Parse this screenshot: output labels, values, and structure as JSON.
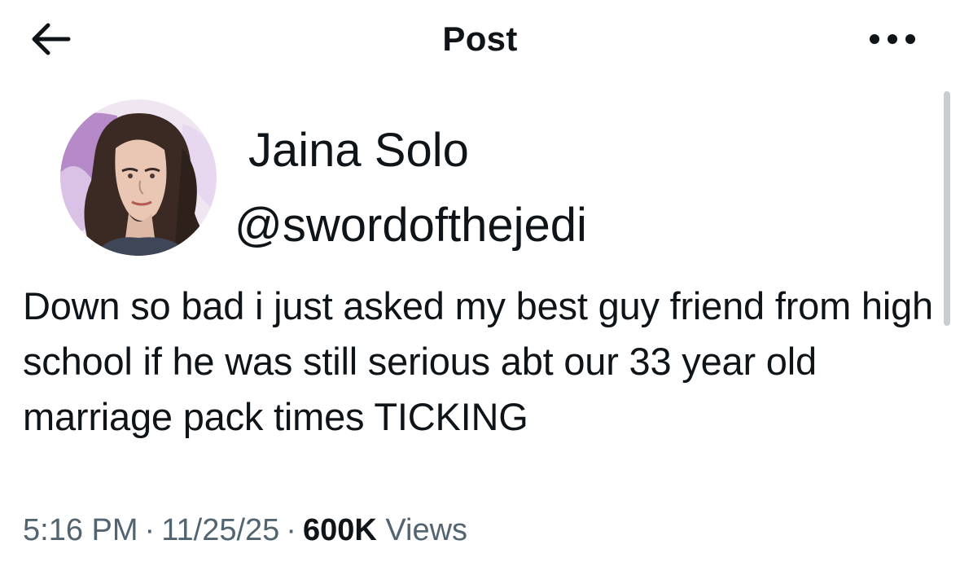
{
  "header": {
    "title": "Post",
    "back_icon": "arrow-left-icon",
    "more_icon": "more-horizontal-icon"
  },
  "author": {
    "display_name": "Jaina Solo",
    "handle": "@swordofthejedi",
    "avatar": "illustrated-portrait-avatar"
  },
  "post": {
    "text": "Down so bad i just asked my best guy friend from high school if he was still serious abt our 33 year old marriage pack times TICKING",
    "time": "5:16 PM",
    "date": "11/25/25",
    "views_count": "600K",
    "views_label": "Views",
    "separator": "·"
  },
  "colors": {
    "text_primary": "#0f1419",
    "text_secondary": "#536471"
  }
}
